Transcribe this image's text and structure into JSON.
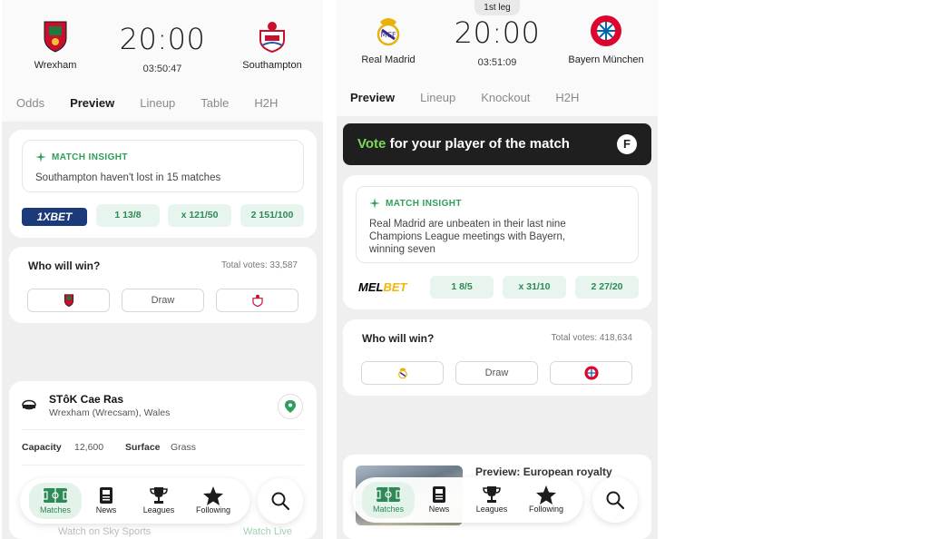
{
  "left": {
    "home_team": "Wrexham",
    "away_team": "Southampton",
    "kickoff": "20:00",
    "countdown": "03:50:47",
    "tabs": [
      "Odds",
      "Preview",
      "Lineup",
      "Table",
      "H2H"
    ],
    "active_tab": "Preview",
    "insight_title": "MATCH INSIGHT",
    "insight_text": "Southampton haven't lost in 15 matches",
    "bookmaker": "1XBET",
    "odds": [
      "1 13/8",
      "x 121/50",
      "2 151/100"
    ],
    "vote_title": "Who will win?",
    "vote_total": "Total votes: 33,587",
    "draw_label": "Draw",
    "venue_name": "STôK Cae Ras",
    "venue_location": "Wrexham (Wrecsam), Wales",
    "capacity_label": "Capacity",
    "capacity_value": "12,600",
    "surface_label": "Surface",
    "surface_value": "Grass",
    "watch_text": "Watch on Sky Sports",
    "watch_live": "Watch Live"
  },
  "right": {
    "leg": "1st leg",
    "home_team": "Real Madrid",
    "away_team": "Bayern München",
    "kickoff": "20:00",
    "countdown": "03:51:09",
    "tabs": [
      "Preview",
      "Lineup",
      "Knockout",
      "H2H"
    ],
    "active_tab": "Preview",
    "potm_highlight": "Vote",
    "potm_rest": " for your player of the match",
    "insight_title": "MATCH INSIGHT",
    "insight_lines": [
      "Real Madrid are unbeaten in their last nine",
      "Champions League meetings with Bayern,",
      "winning seven"
    ],
    "bookmaker_a": "MEL",
    "bookmaker_b": "BET",
    "odds": [
      "1  8/5",
      "x  31/10",
      "2  27/20"
    ],
    "vote_title": "Who will win?",
    "vote_total": "Total votes: 418,634",
    "draw_label": "Draw",
    "news_title": "Preview: European royalty"
  },
  "nav": {
    "items": [
      "Matches",
      "News",
      "Leagues",
      "Following"
    ]
  },
  "colors": {
    "accent_green": "#2e9e5b",
    "odds_bg": "#e8f4ee",
    "potm_bg": "#1f1f1f",
    "vote_green": "#7ed957",
    "onexbet_blue": "#1c3a7a",
    "melbet_yellow": "#f2b705"
  },
  "icons": [
    "sparkle-icon",
    "stadium-icon",
    "map-pin-icon",
    "pitch-icon",
    "news-icon",
    "trophy-icon",
    "star-icon",
    "search-icon"
  ]
}
